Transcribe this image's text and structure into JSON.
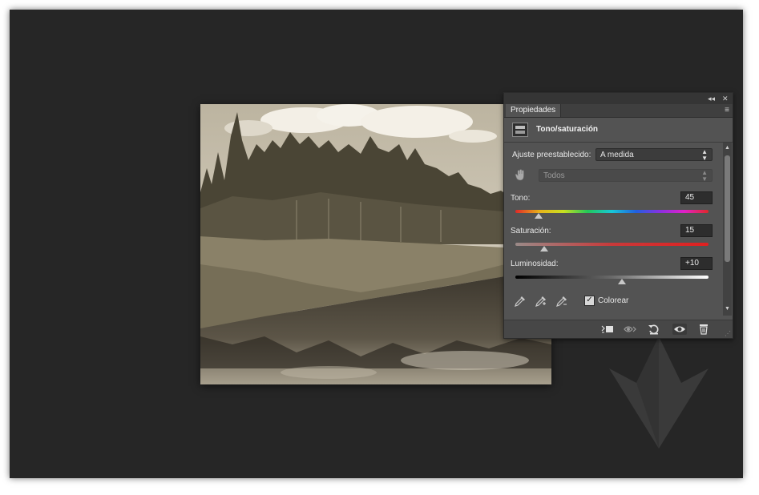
{
  "panel": {
    "topbar": {
      "collapse_glyph": "◂◂",
      "close_glyph": "✕"
    },
    "tab_label": "Propiedades",
    "tab_menu_glyph": "≡",
    "title": "Tono/saturación",
    "preset_label": "Ajuste preestablecido:",
    "preset_value": "A medida",
    "channel_value": "Todos",
    "tono": {
      "label": "Tono:",
      "value": "45",
      "fraction": 0.12
    },
    "saturacion": {
      "label": "Saturación:",
      "value": "15",
      "fraction": 0.15
    },
    "luminosidad": {
      "label": "Luminosidad:",
      "value": "+10",
      "fraction": 0.55
    },
    "colorize_label": "Colorear",
    "colorize_checked": true,
    "check_glyph": "✓",
    "icons": {
      "eyedropper": "eyedropper-icon",
      "eyedropper_plus": "eyedropper-plus-icon",
      "eyedropper_minus": "eyedropper-minus-icon",
      "target_hand": "target-hand-icon",
      "clip": "clip-to-layer-icon",
      "view_previous": "view-previous-icon",
      "reset": "reset-icon",
      "visibility": "eye-icon",
      "delete": "trash-icon"
    }
  },
  "colors": {
    "workspace": "#262626",
    "panel": "#535353",
    "sepia": "#b4ab96"
  }
}
